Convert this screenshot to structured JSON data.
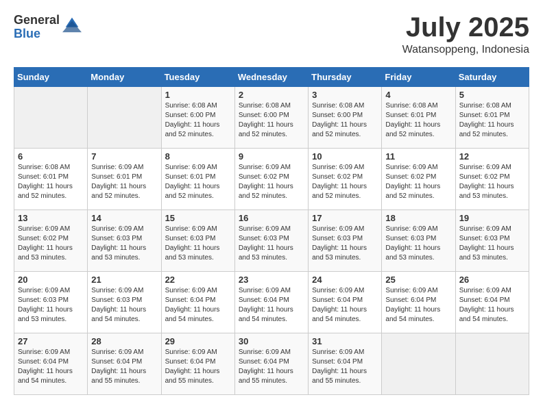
{
  "logo": {
    "general": "General",
    "blue": "Blue"
  },
  "title": {
    "month": "July 2025",
    "location": "Watansoppeng, Indonesia"
  },
  "days_of_week": [
    "Sunday",
    "Monday",
    "Tuesday",
    "Wednesday",
    "Thursday",
    "Friday",
    "Saturday"
  ],
  "weeks": [
    [
      {
        "day": "",
        "content": ""
      },
      {
        "day": "",
        "content": ""
      },
      {
        "day": "1",
        "content": "Sunrise: 6:08 AM\nSunset: 6:00 PM\nDaylight: 11 hours and 52 minutes."
      },
      {
        "day": "2",
        "content": "Sunrise: 6:08 AM\nSunset: 6:00 PM\nDaylight: 11 hours and 52 minutes."
      },
      {
        "day": "3",
        "content": "Sunrise: 6:08 AM\nSunset: 6:00 PM\nDaylight: 11 hours and 52 minutes."
      },
      {
        "day": "4",
        "content": "Sunrise: 6:08 AM\nSunset: 6:01 PM\nDaylight: 11 hours and 52 minutes."
      },
      {
        "day": "5",
        "content": "Sunrise: 6:08 AM\nSunset: 6:01 PM\nDaylight: 11 hours and 52 minutes."
      }
    ],
    [
      {
        "day": "6",
        "content": "Sunrise: 6:08 AM\nSunset: 6:01 PM\nDaylight: 11 hours and 52 minutes."
      },
      {
        "day": "7",
        "content": "Sunrise: 6:09 AM\nSunset: 6:01 PM\nDaylight: 11 hours and 52 minutes."
      },
      {
        "day": "8",
        "content": "Sunrise: 6:09 AM\nSunset: 6:01 PM\nDaylight: 11 hours and 52 minutes."
      },
      {
        "day": "9",
        "content": "Sunrise: 6:09 AM\nSunset: 6:02 PM\nDaylight: 11 hours and 52 minutes."
      },
      {
        "day": "10",
        "content": "Sunrise: 6:09 AM\nSunset: 6:02 PM\nDaylight: 11 hours and 52 minutes."
      },
      {
        "day": "11",
        "content": "Sunrise: 6:09 AM\nSunset: 6:02 PM\nDaylight: 11 hours and 52 minutes."
      },
      {
        "day": "12",
        "content": "Sunrise: 6:09 AM\nSunset: 6:02 PM\nDaylight: 11 hours and 53 minutes."
      }
    ],
    [
      {
        "day": "13",
        "content": "Sunrise: 6:09 AM\nSunset: 6:02 PM\nDaylight: 11 hours and 53 minutes."
      },
      {
        "day": "14",
        "content": "Sunrise: 6:09 AM\nSunset: 6:03 PM\nDaylight: 11 hours and 53 minutes."
      },
      {
        "day": "15",
        "content": "Sunrise: 6:09 AM\nSunset: 6:03 PM\nDaylight: 11 hours and 53 minutes."
      },
      {
        "day": "16",
        "content": "Sunrise: 6:09 AM\nSunset: 6:03 PM\nDaylight: 11 hours and 53 minutes."
      },
      {
        "day": "17",
        "content": "Sunrise: 6:09 AM\nSunset: 6:03 PM\nDaylight: 11 hours and 53 minutes."
      },
      {
        "day": "18",
        "content": "Sunrise: 6:09 AM\nSunset: 6:03 PM\nDaylight: 11 hours and 53 minutes."
      },
      {
        "day": "19",
        "content": "Sunrise: 6:09 AM\nSunset: 6:03 PM\nDaylight: 11 hours and 53 minutes."
      }
    ],
    [
      {
        "day": "20",
        "content": "Sunrise: 6:09 AM\nSunset: 6:03 PM\nDaylight: 11 hours and 53 minutes."
      },
      {
        "day": "21",
        "content": "Sunrise: 6:09 AM\nSunset: 6:03 PM\nDaylight: 11 hours and 54 minutes."
      },
      {
        "day": "22",
        "content": "Sunrise: 6:09 AM\nSunset: 6:04 PM\nDaylight: 11 hours and 54 minutes."
      },
      {
        "day": "23",
        "content": "Sunrise: 6:09 AM\nSunset: 6:04 PM\nDaylight: 11 hours and 54 minutes."
      },
      {
        "day": "24",
        "content": "Sunrise: 6:09 AM\nSunset: 6:04 PM\nDaylight: 11 hours and 54 minutes."
      },
      {
        "day": "25",
        "content": "Sunrise: 6:09 AM\nSunset: 6:04 PM\nDaylight: 11 hours and 54 minutes."
      },
      {
        "day": "26",
        "content": "Sunrise: 6:09 AM\nSunset: 6:04 PM\nDaylight: 11 hours and 54 minutes."
      }
    ],
    [
      {
        "day": "27",
        "content": "Sunrise: 6:09 AM\nSunset: 6:04 PM\nDaylight: 11 hours and 54 minutes."
      },
      {
        "day": "28",
        "content": "Sunrise: 6:09 AM\nSunset: 6:04 PM\nDaylight: 11 hours and 55 minutes."
      },
      {
        "day": "29",
        "content": "Sunrise: 6:09 AM\nSunset: 6:04 PM\nDaylight: 11 hours and 55 minutes."
      },
      {
        "day": "30",
        "content": "Sunrise: 6:09 AM\nSunset: 6:04 PM\nDaylight: 11 hours and 55 minutes."
      },
      {
        "day": "31",
        "content": "Sunrise: 6:09 AM\nSunset: 6:04 PM\nDaylight: 11 hours and 55 minutes."
      },
      {
        "day": "",
        "content": ""
      },
      {
        "day": "",
        "content": ""
      }
    ]
  ]
}
